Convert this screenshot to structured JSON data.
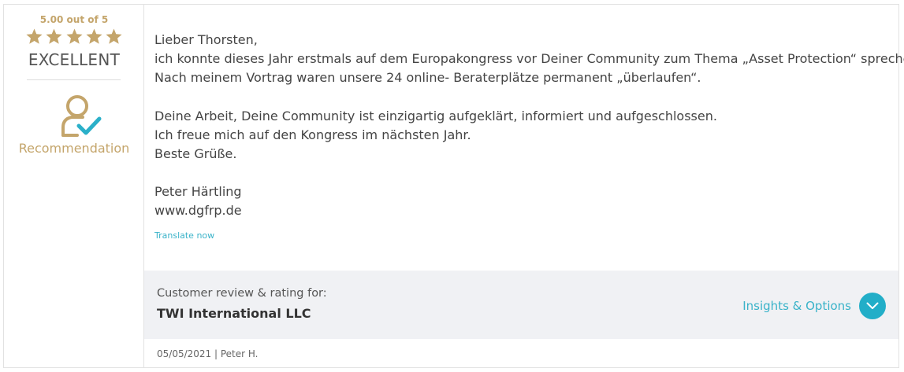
{
  "rating": {
    "score_text": "5.00 out of 5",
    "stars_filled": 5,
    "stars_total": 5,
    "verdict": "EXCELLENT",
    "recommendation_label": "Recommendation",
    "star_color": "#c4a56b"
  },
  "review": {
    "lines": [
      "Lieber Thorsten,",
      "ich konnte dieses Jahr erstmals auf dem Europakongress vor Deiner Community zum Thema „Asset Protection“ sprechen.",
      "Nach meinem Vortrag waren unsere 24 online- Beraterplätze permanent „überlaufen“.",
      "Deine Arbeit, Deine Community ist einzigartig aufgeklärt, informiert und aufgeschlossen.",
      "Ich freue mich auf den Kongress im nächsten Jahr.",
      "Beste Grüße.",
      "Peter Härtling",
      "www.dgfrp.de"
    ],
    "translate_link": "Translate now"
  },
  "footer": {
    "review_for_label": "Customer review & rating for:",
    "company": "TWI International LLC",
    "insights_label": "Insights & Options",
    "insights_icon": "chevron-down-icon"
  },
  "meta": {
    "line": "05/05/2021 | Peter H."
  },
  "colors": {
    "gold": "#c4a56b",
    "teal": "#22aec8",
    "band": "#f0f1f4"
  }
}
